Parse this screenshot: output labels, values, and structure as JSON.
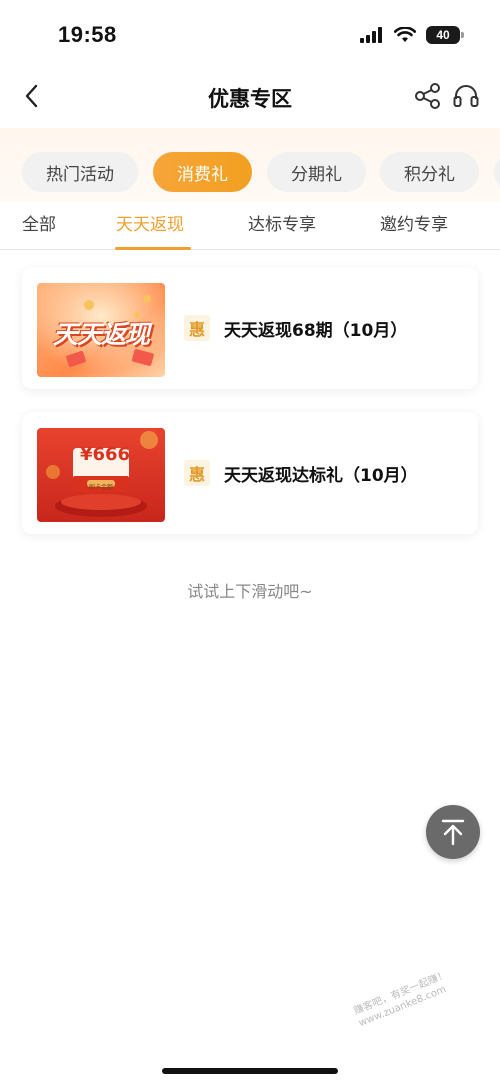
{
  "status_bar": {
    "time": "19:58",
    "battery": "40",
    "icons": [
      "signal-icon",
      "wifi-icon",
      "battery-icon"
    ]
  },
  "nav": {
    "title": "优惠专区",
    "back_icon": "chevron-left-icon",
    "share_icon": "share-icon",
    "service_icon": "headset-icon"
  },
  "categories": [
    {
      "label": "热门活动",
      "active": false
    },
    {
      "label": "消费礼",
      "active": true
    },
    {
      "label": "分期礼",
      "active": false
    },
    {
      "label": "积分礼",
      "active": false
    }
  ],
  "sub_tabs": [
    {
      "label": "全部",
      "active": false
    },
    {
      "label": "天天返现",
      "active": true
    },
    {
      "label": "达标专享",
      "active": false
    },
    {
      "label": "邀约专享",
      "active": false
    }
  ],
  "cards": [
    {
      "badge": "惠",
      "title": "天天返现68期（10月）",
      "image_text": "天天返现"
    },
    {
      "badge": "惠",
      "title": "天天返现达标礼（10月）",
      "image_text": "¥666",
      "image_subtext": "刷卡金额"
    }
  ],
  "scroll_hint": "试试上下滑动吧~",
  "back_to_top_icon": "arrow-up-to-top-icon",
  "watermark": {
    "line1": "赚客吧，有奖一起赚！",
    "line2": "www.zuanke8.com"
  },
  "colors": {
    "accent": "#f0a030",
    "pill_active": "#f5a623",
    "badge_bg": "#fdf3e1"
  }
}
